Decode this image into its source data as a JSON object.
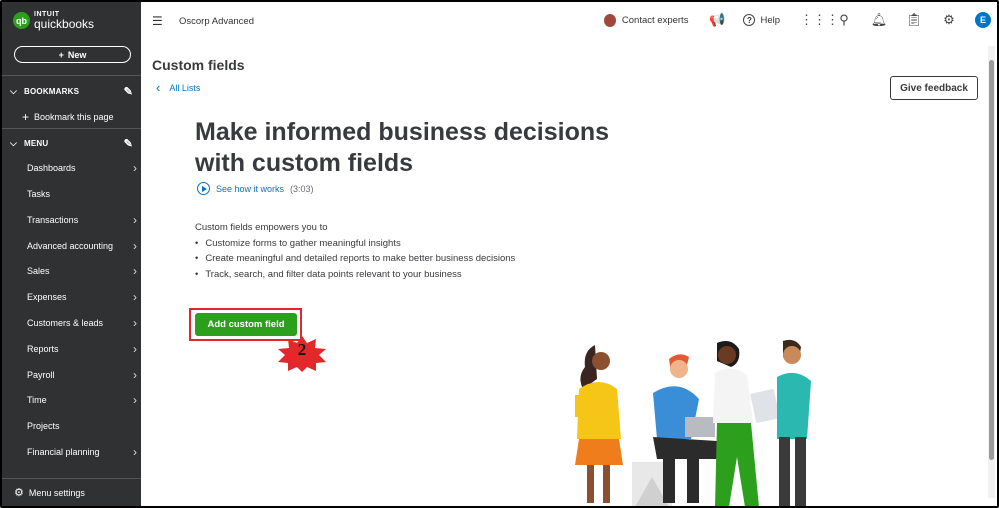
{
  "logo": {
    "badge": "qb",
    "line1": "INTUIT",
    "line2": "quickbooks"
  },
  "sidebar": {
    "new_label": "New",
    "bookmarks_header": "BOOKMARKS",
    "bookmark_this_page": "Bookmark this page",
    "menu_header": "MENU",
    "items": [
      {
        "label": "Dashboards",
        "arrow": true
      },
      {
        "label": "Tasks",
        "arrow": false
      },
      {
        "label": "Transactions",
        "arrow": true
      },
      {
        "label": "Advanced accounting",
        "arrow": true
      },
      {
        "label": "Sales",
        "arrow": true
      },
      {
        "label": "Expenses",
        "arrow": true
      },
      {
        "label": "Customers & leads",
        "arrow": true
      },
      {
        "label": "Reports",
        "arrow": true
      },
      {
        "label": "Payroll",
        "arrow": true
      },
      {
        "label": "Time",
        "arrow": true
      },
      {
        "label": "Projects",
        "arrow": false
      },
      {
        "label": "Financial planning",
        "arrow": true
      }
    ],
    "menu_settings": "Menu settings"
  },
  "topbar": {
    "company": "Oscorp Advanced",
    "contact_experts": "Contact experts",
    "help": "Help",
    "user_initial": "E"
  },
  "main": {
    "page_title": "Custom fields",
    "back_link": "All Lists",
    "feedback_button": "Give feedback",
    "hero_line1": "Make informed business decisions",
    "hero_line2": "with custom fields",
    "see_how": "See how it works",
    "duration": "(3:03)",
    "intro": "Custom fields empowers you to",
    "bullets": [
      "Customize forms to gather meaningful insights",
      "Create meaningful and detailed reports to make better business decisions",
      "Track, search, and filter data points relevant to your business"
    ],
    "add_button": "Add custom field",
    "step_number": "2"
  },
  "colors": {
    "brand_green": "#2ca01c",
    "link_blue": "#0077c5",
    "sidebar_bg": "#2f3133",
    "highlight_red": "#e3282c"
  }
}
